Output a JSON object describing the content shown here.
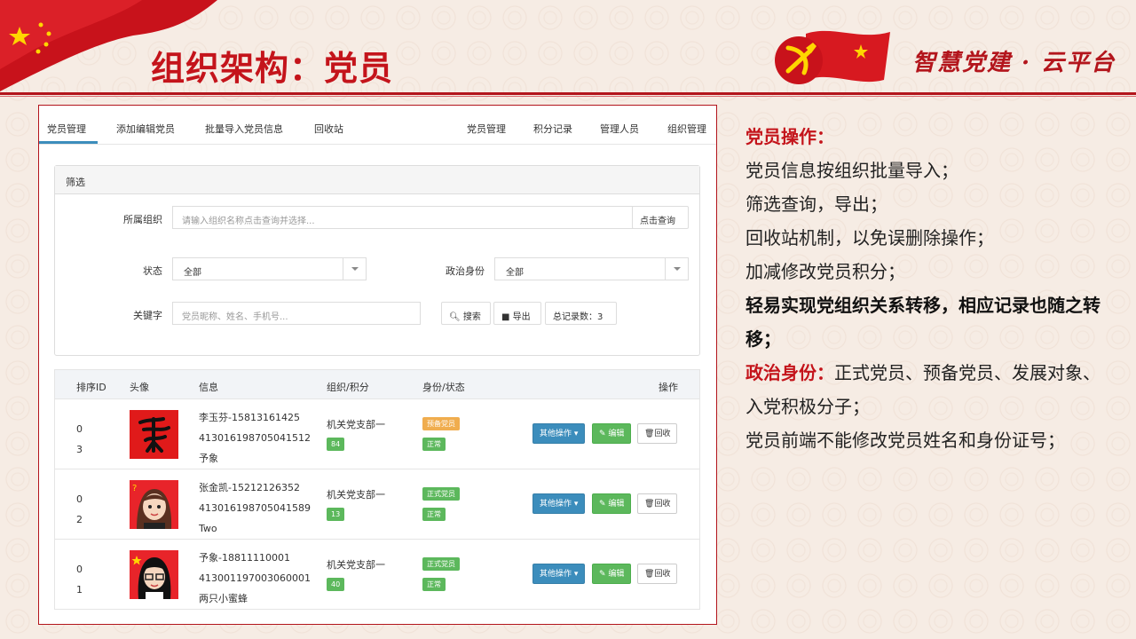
{
  "slide": {
    "title": "组织架构：党员",
    "brand": "智慧党建 · 云平台"
  },
  "topnav": {
    "left_tabs": [
      "党员管理",
      "添加编辑党员",
      "批量导入党员信息",
      "回收站"
    ],
    "right_tabs": [
      "党员管理",
      "积分记录",
      "管理人员",
      "组织管理"
    ],
    "active_tab": "党员管理"
  },
  "filter": {
    "heading": "筛选",
    "org_label": "所属组织",
    "org_placeholder": "请输入组织名称点击查询并选择...",
    "org_query_button": "点击查询",
    "status_label": "状态",
    "status_value": "全部",
    "political_label": "政治身份",
    "political_value": "全部",
    "keyword_label": "关键字",
    "keyword_placeholder": "党员昵称、姓名、手机号...",
    "search_button": "搜索",
    "export_button": "导出",
    "total_records": "总记录数：3"
  },
  "table": {
    "headers": [
      "排序ID",
      "头像",
      "信息",
      "组织/积分",
      "身份/状态",
      "操作"
    ],
    "rows": [
      {
        "id_line1": "0",
        "id_line2": "3",
        "name_phone": "李玉芬-15813161425",
        "id_card": "413016198705041512",
        "nickname": "予象",
        "org": "机关党支部一",
        "score": "84",
        "role": "预备党员",
        "status": "正常"
      },
      {
        "id_line1": "0",
        "id_line2": "2",
        "name_phone": "张金凯-15212126352",
        "id_card": "413016198705041589",
        "nickname": "Two",
        "org": "机关党支部一",
        "score": "13",
        "role": "正式党员",
        "status": "正常"
      },
      {
        "id_line1": "0",
        "id_line2": "1",
        "name_phone": "予象-18811110001",
        "id_card": "413001197003060001",
        "nickname": "两只小蜜蜂",
        "org": "机关党支部一",
        "score": "40",
        "role": "正式党员",
        "status": "正常"
      }
    ],
    "actions": {
      "more": "其他操作",
      "edit": "编辑",
      "recycle": "回收"
    }
  },
  "notes": {
    "heading": "党员操作：",
    "line1": "党员信息按组织批量导入；",
    "line2": "筛选查询，导出；",
    "line3": "回收站机制，以免误删除操作；",
    "line4": "加减修改党员积分；",
    "line5_bold": "轻易实现党组织关系转移，相应记录也随之转移；",
    "political_heading": "政治身份：",
    "political_text": "正式党员、预备党员、发展对象、入党积极分子；",
    "line7": "党员前端不能修改党员姓名和身份证号；"
  },
  "colors": {
    "party_red": "#c4141b",
    "primary_blue": "#3c8dbc",
    "success_green": "#5cb85c",
    "warning_orange": "#f0ad4e"
  }
}
